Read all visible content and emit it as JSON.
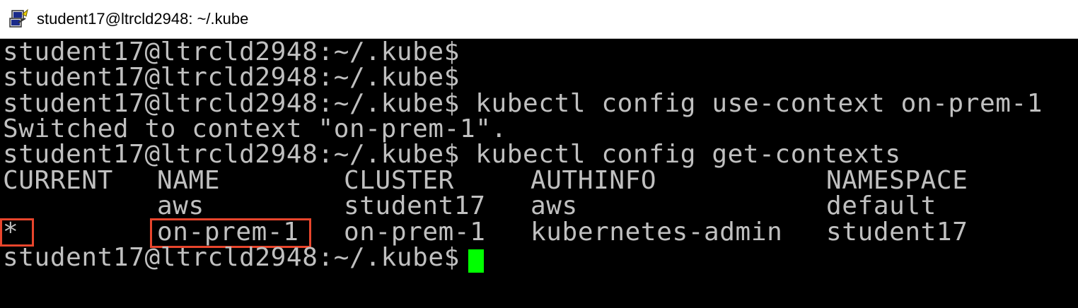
{
  "window": {
    "title": "student17@ltrcld2948: ~/.kube",
    "icon": "putty-icon",
    "colors": {
      "terminal_bg": "#000000",
      "terminal_fg": "#c0c0c0",
      "highlight": "#e8452c",
      "cursor": "#00ff00"
    }
  },
  "terminal": {
    "lines": [
      "student17@ltrcld2948:~/.kube$",
      "student17@ltrcld2948:~/.kube$",
      "student17@ltrcld2948:~/.kube$ kubectl config use-context on-prem-1",
      "Switched to context \"on-prem-1\".",
      "student17@ltrcld2948:~/.kube$ kubectl config get-contexts"
    ],
    "table": {
      "headers": [
        "CURRENT",
        "NAME",
        "CLUSTER",
        "AUTHINFO",
        "NAMESPACE"
      ],
      "rows": [
        [
          "",
          "aws",
          "student17",
          "aws",
          "default"
        ],
        [
          "*",
          "on-prem-1",
          "on-prem-1",
          "kubernetes-admin",
          "student17"
        ]
      ]
    },
    "final_prompt": "student17@ltrcld2948:~/.kube$"
  }
}
